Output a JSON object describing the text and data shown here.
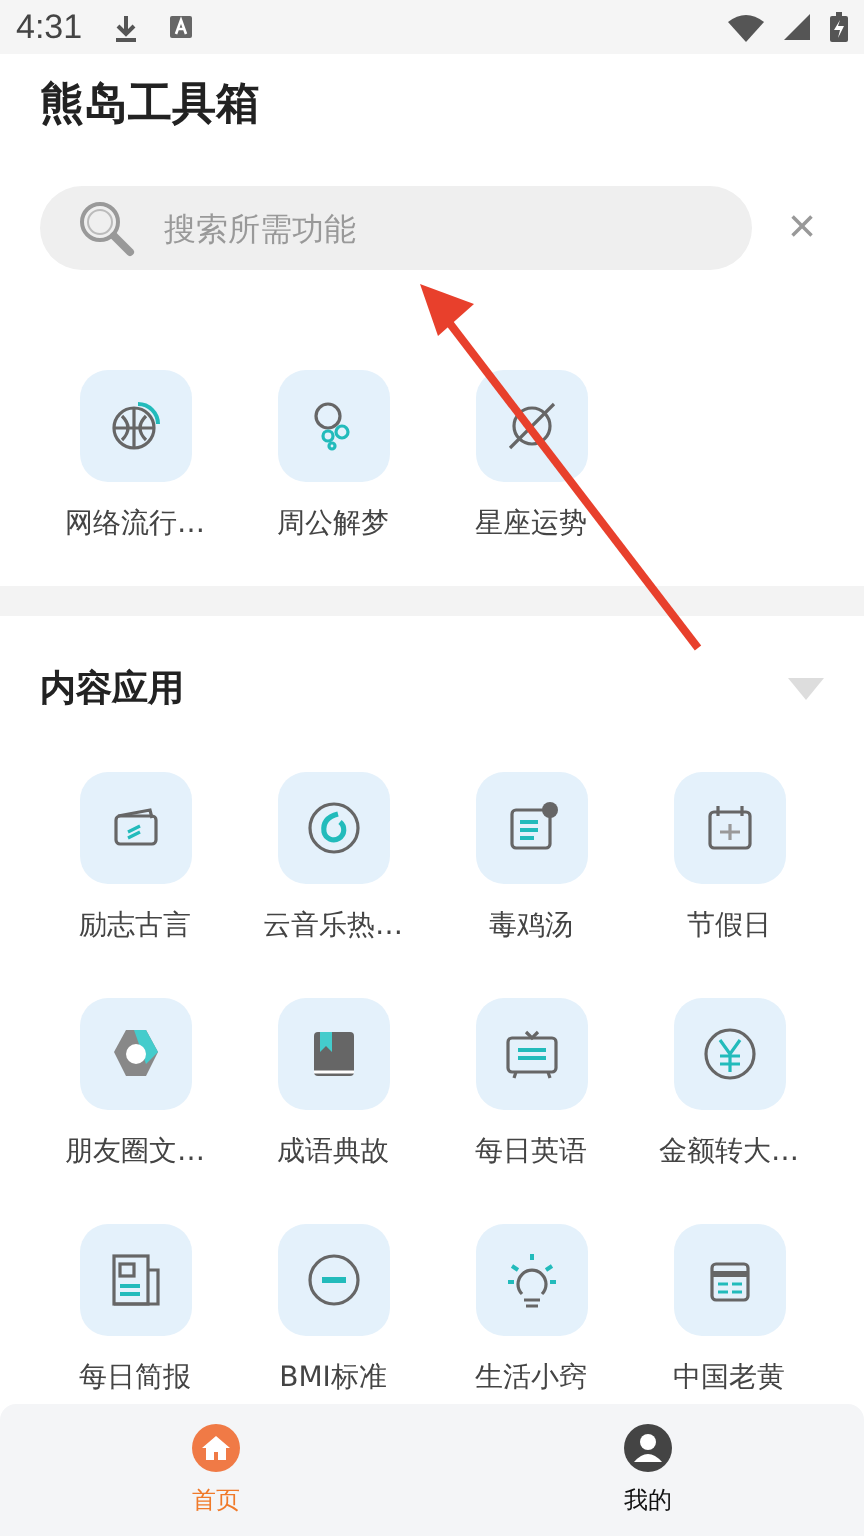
{
  "status_bar": {
    "time": "4:31"
  },
  "app_title": "熊岛工具箱",
  "search": {
    "placeholder": "搜索所需功能",
    "clear": "×"
  },
  "sections": [
    {
      "items": [
        {
          "label": "网络流行…"
        },
        {
          "label": "周公解梦"
        },
        {
          "label": "星座运势"
        }
      ]
    },
    {
      "title": "内容应用",
      "items": [
        {
          "label": "励志古言"
        },
        {
          "label": "云音乐热…"
        },
        {
          "label": "毒鸡汤"
        },
        {
          "label": "节假日"
        },
        {
          "label": "朋友圈文…"
        },
        {
          "label": "成语典故"
        },
        {
          "label": "每日英语"
        },
        {
          "label": "金额转大…"
        },
        {
          "label": "每日简报"
        },
        {
          "label": "BMI标准"
        },
        {
          "label": "生活小窍"
        },
        {
          "label": "中国老黄"
        }
      ]
    }
  ],
  "bottom_nav": [
    {
      "label": "首页",
      "selected": true
    },
    {
      "label": "我的",
      "selected": false
    }
  ]
}
